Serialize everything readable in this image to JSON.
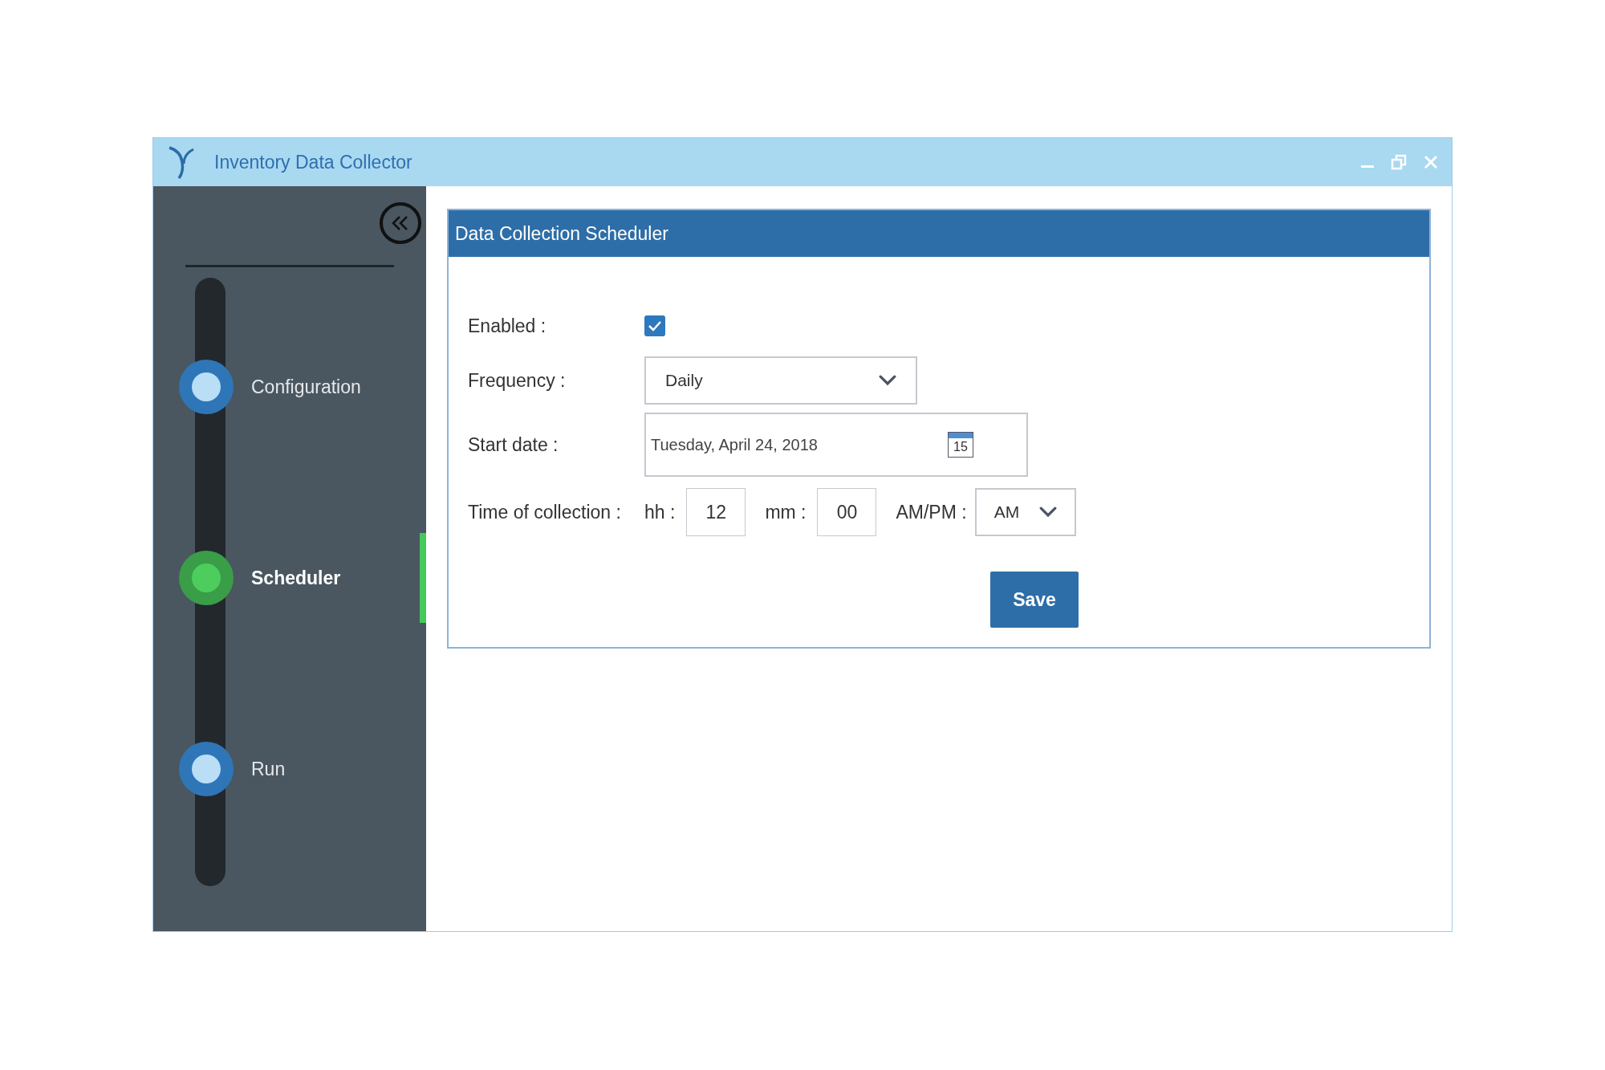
{
  "window": {
    "title": "Inventory Data Collector"
  },
  "steps": [
    {
      "label": "Configuration",
      "selected": false
    },
    {
      "label": "Scheduler",
      "selected": true
    },
    {
      "label": "Run",
      "selected": false
    }
  ],
  "panel": {
    "title": "Data Collection Scheduler"
  },
  "form": {
    "enabled": {
      "label": "Enabled :",
      "checked": true
    },
    "frequency": {
      "label": "Frequency :",
      "value": "Daily"
    },
    "start_date": {
      "label": "Start date :",
      "value": "Tuesday, April 24, 2018",
      "calendar_day": "15"
    },
    "time": {
      "label": "Time of collection :",
      "hh_label": "hh :",
      "hh": "12",
      "mm_label": "mm :",
      "mm": "00",
      "ampm_label": "AM/PM :",
      "ampm": "AM"
    }
  },
  "buttons": [
    {
      "label": "Save"
    }
  ]
}
